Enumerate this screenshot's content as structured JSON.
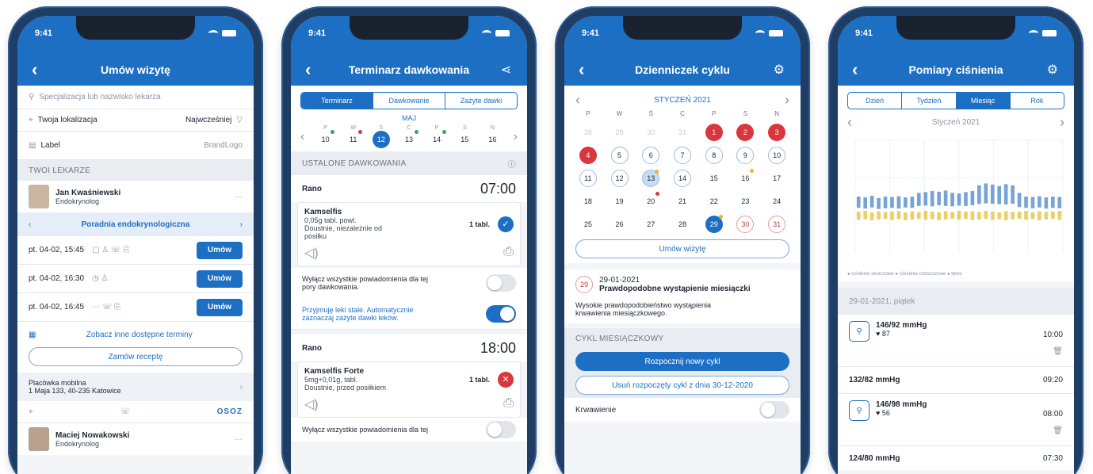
{
  "status_time": "9:41",
  "phone1": {
    "title": "Umów wizytę",
    "search_placeholder": "Specjalizacja lub nazwisko lekarza",
    "location": "Twoja lokalizacja",
    "sort": "Najwcześniej",
    "label_left": "Label",
    "label_right": "BrandLogo",
    "section": "TWOI LEKARZE",
    "doctor1_name": "Jan Kwaśniewski",
    "doctor1_spec": "Endokrynolog",
    "clinic": "Poradnia endokrynologiczna",
    "slots": [
      {
        "time": "pt. 04-02, 15:45",
        "btn": "Umów"
      },
      {
        "time": "pt. 04-02, 16:30",
        "btn": "Umów"
      },
      {
        "time": "pt. 04-02, 16:45",
        "btn": "Umów"
      }
    ],
    "more_link": "Zobacz inne dostępne terminy",
    "prescription_btn": "Zamów receptę",
    "facility_name": "Placówka mobilna",
    "facility_addr": "1 Maja 133, 40-235 Katowice",
    "facility_brand": "OSOZ",
    "doctor2_name": "Maciej Nowakowski",
    "doctor2_spec": "Endokrynolog"
  },
  "phone2": {
    "title": "Terminarz dawkowania",
    "tabs": [
      "Terminarz",
      "Dawkowanie",
      "Zażyte dawki"
    ],
    "month": "MAJ",
    "day_heads": [
      "P",
      "W",
      "Ś",
      "C",
      "P",
      "S",
      "N"
    ],
    "days": [
      "10",
      "11",
      "12",
      "13",
      "14",
      "15",
      "16"
    ],
    "section": "USTALONE DAWKOWANIA",
    "block1_label": "Rano",
    "block1_time": "07:00",
    "drug1_name": "Kamselfis",
    "drug1_desc1": "0,05g  tabl. powl.",
    "drug1_desc2": "Doustnie, niezależnie od",
    "drug1_desc3": "posiłku",
    "drug1_dose": "1 tabl.",
    "opt1a": "Wyłącz wszystkie powiadomienia dla tej",
    "opt1b": "pory dawkowania.",
    "opt2a": "Przyjmuję leki stale. Automatycznie",
    "opt2b": "zaznaczaj zażyte dawki leków.",
    "block2_label": "Rano",
    "block2_time": "18:00",
    "drug2_name": "Kamselfis Forte",
    "drug2_desc1": "5mg+0,01g, tabl.",
    "drug2_desc2": "Doustnie, przed posiłkiem",
    "drug2_dose": "1 tabl.",
    "opt3": "Wyłącz wszystkie powiadomienia dla tej"
  },
  "phone3": {
    "title": "Dzienniczek cyklu",
    "month": "STYCZEŃ 2021",
    "day_heads": [
      "P",
      "W",
      "Ś",
      "C",
      "P",
      "S",
      "N"
    ],
    "appt_btn": "Umów wizytę",
    "event_day": "29",
    "event_date": "29-01-2021",
    "event_title": "Prawdopodobne wystąpienie miesiączki",
    "event_desc1": "Wysokie prawdopodobieństwo wystąpienia",
    "event_desc2": "krwawienia miesiączkowego.",
    "section": "CYKL MIESIĄCZKOWY",
    "start_btn": "Rozpocznij nowy cykl",
    "remove_btn": "Usuń rozpoczęty cykl z dnia 30-12-2020",
    "bottom_label": "Krwawienie"
  },
  "phone4": {
    "title": "Pomiary ciśnienia",
    "tabs": [
      "Dzień",
      "Tydzień",
      "Miesiąc",
      "Rok"
    ],
    "month": "Styczeń 2021",
    "legend": "● ciśnienie skurczowe  ● ciśnienie rozkurczowe  ● tętno",
    "date_header": "29-01-2021, piątek",
    "m1_value": "146/92 mmHg",
    "m1_pulse": "87",
    "m1_time": "10:00",
    "m2_value": "132/82 mmHg",
    "m2_time": "09:20",
    "m3_value": "146/98 mmHg",
    "m3_pulse": "56",
    "m3_time": "08:00",
    "m4_value": "124/80 mmHg",
    "m4_time": "07:30"
  },
  "chart_data": {
    "type": "bar",
    "title": "",
    "xlabel": "",
    "ylabel": "",
    "ylim": [
      0,
      300
    ],
    "x": [
      1,
      2,
      3,
      4,
      5,
      6,
      7,
      8,
      9,
      10,
      11,
      12,
      13,
      14,
      15,
      16,
      17,
      18,
      19,
      20,
      21,
      22,
      23,
      24,
      25,
      26,
      27,
      28,
      29,
      30,
      31
    ],
    "series": [
      {
        "values_high": [
          150,
          148,
          152,
          146,
          150,
          149,
          151,
          148,
          150,
          160,
          162,
          165,
          163,
          166,
          160,
          158,
          162,
          165,
          180,
          185,
          182,
          178,
          183,
          180,
          160,
          150,
          149,
          151,
          148,
          150,
          149
        ],
        "values_low": [
          120,
          118,
          121,
          117,
          119,
          120,
          118,
          121,
          120,
          125,
          126,
          124,
          127,
          125,
          124,
          126,
          125,
          127,
          130,
          132,
          131,
          130,
          129,
          131,
          122,
          120,
          119,
          121,
          118,
          120,
          119
        ]
      },
      {
        "values_high": [
          110,
          112,
          108,
          111,
          109,
          110,
          112,
          108,
          111,
          109,
          112,
          110,
          108,
          111,
          109,
          112,
          110,
          111,
          109,
          112,
          110,
          108,
          111,
          109,
          110,
          112,
          108,
          111,
          109,
          110,
          112
        ],
        "values_low": [
          88,
          90,
          87,
          89,
          91,
          88,
          90,
          87,
          89,
          91,
          88,
          90,
          87,
          89,
          91,
          88,
          90,
          87,
          89,
          91,
          88,
          90,
          87,
          89,
          91,
          88,
          90,
          87,
          89,
          91,
          88
        ]
      }
    ],
    "colors": [
      "#5f93cf",
      "#e8c84f"
    ]
  }
}
